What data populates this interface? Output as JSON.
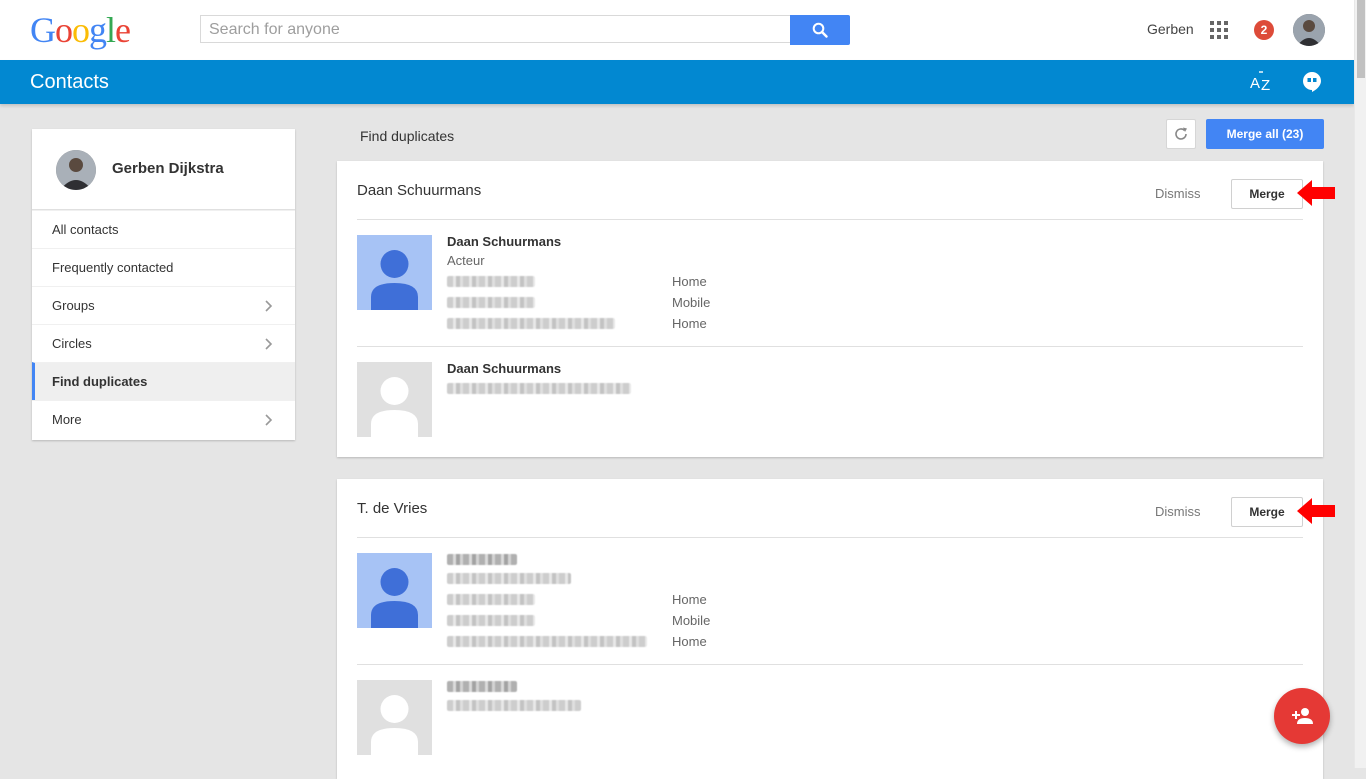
{
  "header": {
    "logo": [
      "G",
      "o",
      "o",
      "g",
      "l",
      "e"
    ],
    "logo_colors": [
      "#4285f4",
      "#ea4335",
      "#fbbc05",
      "#4285f4",
      "#34a853",
      "#ea4335"
    ],
    "search_placeholder": "Search for anyone",
    "user_name": "Gerben",
    "notification_count": "2"
  },
  "appbar": {
    "title": "Contacts"
  },
  "sidebar": {
    "profile_name": "Gerben Dijkstra",
    "items": [
      {
        "label": "All contacts"
      },
      {
        "label": "Frequently contacted"
      },
      {
        "label": "Groups"
      },
      {
        "label": "Circles"
      },
      {
        "label": "Find duplicates"
      },
      {
        "label": "More"
      }
    ]
  },
  "main": {
    "heading": "Find duplicates",
    "merge_all_label": "Merge all (23)",
    "groups": [
      {
        "title": "Daan Schuurmans",
        "dismiss_label": "Dismiss",
        "merge_label": "Merge",
        "contacts": [
          {
            "name": "Daan Schuurmans",
            "subtitle": "Acteur",
            "labels": [
              "Home",
              "Mobile",
              "Home"
            ]
          },
          {
            "name": "Daan Schuurmans"
          }
        ]
      },
      {
        "title": "T. de Vries",
        "dismiss_label": "Dismiss",
        "merge_label": "Merge",
        "contacts": [
          {
            "labels": [
              "Home",
              "Mobile",
              "Home"
            ]
          },
          {}
        ]
      }
    ]
  },
  "colors": {
    "appbar": "#0288d1",
    "primary_button": "#4285f4",
    "fab": "#e53935",
    "annotation_arrow": "#ff0000",
    "badge": "#dd4b39"
  }
}
